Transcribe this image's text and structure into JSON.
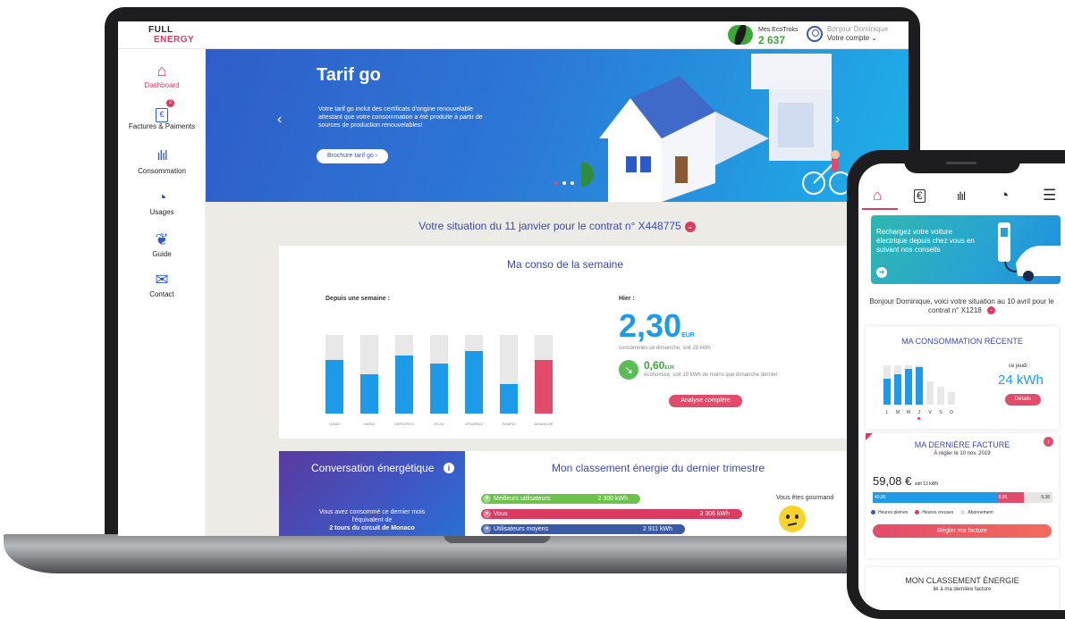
{
  "laptop": {
    "logo": {
      "line1": "FULL",
      "line2": "ENERGY"
    },
    "ecotroks": {
      "label": "Mes EcoTroks",
      "value": "2 637"
    },
    "account": {
      "greeting": "Bonjour Dominique",
      "menu": "Votre compte"
    },
    "sidebar": [
      {
        "label": "Dashboard",
        "icon": "home-icon"
      },
      {
        "label": "Factures & Paiments",
        "icon": "invoice-icon",
        "badge": "2"
      },
      {
        "label": "Consommation",
        "icon": "bar-chart-icon"
      },
      {
        "label": "Usages",
        "icon": "pie-chart-icon"
      },
      {
        "label": "Guide",
        "icon": "leaf-icon"
      },
      {
        "label": "Contact",
        "icon": "mail-icon"
      }
    ],
    "hero": {
      "title": "Tarif go",
      "text": "Votre tarif go inclut des certificats d'origine renouvelable attestant que votre consommation a été produite à partir de sources de production renouvelables!",
      "button": "Brochure tarif go",
      "prev": "‹",
      "next": "›"
    },
    "situation": "Votre situation du 11 janvier pour le contrat n° X448775",
    "conso": {
      "title": "Ma conso de la semaine",
      "since_label": "Depuis une semaine :",
      "yesterday_label": "Hier :",
      "amount": "2,30",
      "amount_unit": "EUR",
      "consumed_text": "consommés ce dimanche, soit 28 kWh",
      "saving_amount": "0,60",
      "saving_unit": "EUR",
      "saving_text": "économisé, soit 15 kWh de moins que dimanche dernier",
      "analysis_button": "Analyse complète",
      "days": [
        "LUNDI",
        "MARDI",
        "MERCREDI",
        "JEUDI",
        "VENDREDI",
        "SAMEDI",
        "DIMANCHE"
      ],
      "fill_levels": [
        0.68,
        0.5,
        0.74,
        0.64,
        0.79,
        0.37,
        0.68
      ]
    },
    "conversation": {
      "title": "Conversation énergétique",
      "text": "Vous avez consommé ce dernier mois l'équivalent de",
      "highlight": "2 tours du circuit de Monaco"
    },
    "ranking": {
      "title": "Mon classement énergie du dernier trimestre",
      "rows": [
        {
          "label": "Meilleurs utilisateurs",
          "value": "2 300 kWh",
          "color": "#6cc24a"
        },
        {
          "label": "Vous",
          "value": "3 306 kWh",
          "color": "#d93b63"
        },
        {
          "label": "Utilisateurs moyens",
          "value": "2 911 kWh",
          "color": "#3a5aa8"
        }
      ],
      "status": "Vous êtes gourmand"
    }
  },
  "phone": {
    "promo": "Rechargez votre voiture électrique depuis chez vous en suivant nos conseils",
    "greeting": "Bonjour Dominique, voici votre situation au 10 avril pour le contrat n° X1218",
    "recent": {
      "title": "MA CONSOMMATION RÉCENTE",
      "day_label": "ce jeudi :",
      "value": "24 kWh",
      "details_button": "Détails",
      "days": [
        "L",
        "M",
        "M",
        "J",
        "V",
        "S",
        "D"
      ],
      "fill_levels": [
        0.66,
        0.78,
        0.9,
        0.95,
        0.6,
        0.45,
        0.32
      ],
      "highlighted_day": 3
    },
    "invoice": {
      "title": "MA DERNIÈRE FACTURE",
      "due": "À régler le 10 nov. 2019",
      "amount": "59,08 €",
      "amount_note": "soit 13 kWh",
      "split": [
        {
          "value": "40,85",
          "color": "#1d9be8",
          "share": 0.69
        },
        {
          "value": "8,85",
          "color": "#e34b6c",
          "share": 0.15
        },
        {
          "value": "9,38",
          "color": "#e8e6e3",
          "share": 0.16
        }
      ],
      "legend": [
        "Heures pleines",
        "Heures creuses",
        "Abonnement"
      ],
      "pay_button": "Régler ma facture"
    },
    "ranking": {
      "title": "MON CLASSEMENT ÉNERGIE",
      "subtitle": "lié à ma dernière facture"
    }
  }
}
